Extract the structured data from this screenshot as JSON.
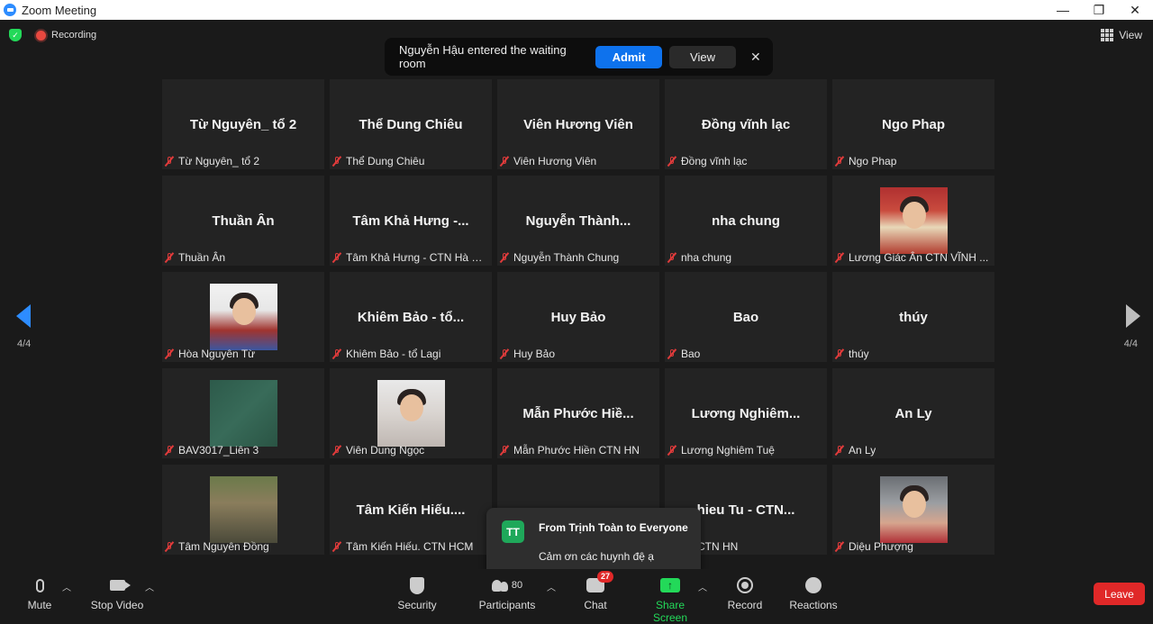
{
  "window": {
    "title": "Zoom Meeting",
    "minimize": "—",
    "restore": "❐",
    "close": "✕"
  },
  "top": {
    "recording_label": "Recording",
    "view_label": "View"
  },
  "notice": {
    "message": "Nguyễn Hậu entered the waiting room",
    "admit": "Admit",
    "view": "View",
    "close": "✕"
  },
  "tiles": [
    {
      "name": "Từ Nguyên_ tổ 2",
      "label": "Từ Nguyên_ tổ 2"
    },
    {
      "name": "Thể Dung Chiêu",
      "label": "Thể Dung Chiêu"
    },
    {
      "name": "Viên Hương Viên",
      "label": "Viên Hương Viên"
    },
    {
      "name": "Đồng vĩnh lạc",
      "label": "Đồng vĩnh lạc"
    },
    {
      "name": "Ngo Phap",
      "label": "Ngo Phap"
    },
    {
      "name": "Thuần Ân",
      "label": "Thuần Ân"
    },
    {
      "name": "Tâm Khả Hưng -...",
      "label": "Tâm Khả Hưng - CTN Hà N..."
    },
    {
      "name": "Nguyễn Thành...",
      "label": "Nguyễn Thành Chung"
    },
    {
      "name": "nha chung",
      "label": "nha chung"
    },
    {
      "name": "",
      "label": "Lương Giác Ân CTN VĨNH ..."
    },
    {
      "name": "",
      "label": "Hòa Nguyên Từ"
    },
    {
      "name": "Khiêm Bảo - tổ...",
      "label": "Khiêm Bảo - tổ Lagi"
    },
    {
      "name": "Huy Bảo",
      "label": "Huy Bảo"
    },
    {
      "name": "Bao",
      "label": "Bao"
    },
    {
      "name": "thúy",
      "label": "thúy"
    },
    {
      "name": "",
      "label": "BAV3017_Liên 3"
    },
    {
      "name": "",
      "label": "Viên Dung Ngọc"
    },
    {
      "name": "Mẫn Phước Hiề...",
      "label": "Mẫn Phước Hiền CTN HN"
    },
    {
      "name": "Lương Nghiêm...",
      "label": "Lương Nghiêm Tuệ"
    },
    {
      "name": "An Ly",
      "label": "An Ly"
    },
    {
      "name": "",
      "label": "Tâm Nguyên Đồng"
    },
    {
      "name": "Tâm Kiến Hiếu....",
      "label": "Tâm Kiến Hiếu. CTN HCM"
    },
    {
      "name": "",
      "label": ""
    },
    {
      "name": "hieu Tu - CTN...",
      "label": "u Tu - CTN HN"
    },
    {
      "name": "",
      "label": "Diệu Phượng"
    }
  ],
  "pager": {
    "left": "4/4",
    "right": "4/4"
  },
  "chat_popup": {
    "avatar": "TT",
    "from": "From Trịnh Toàn to Everyone",
    "message": "Cảm ơn các huynh đệ ạ"
  },
  "toolbar": {
    "mute": "Mute",
    "stop_video": "Stop Video",
    "security": "Security",
    "participants": "Participants",
    "participants_count": "80",
    "chat": "Chat",
    "chat_badge": "27",
    "share_screen": "Share Screen",
    "record": "Record",
    "reactions": "Reactions",
    "leave": "Leave"
  },
  "colors": {
    "accent": "#2D8CFF",
    "share_green": "#23d959",
    "leave_red": "#e02828",
    "admit_blue": "#0e72ed"
  }
}
